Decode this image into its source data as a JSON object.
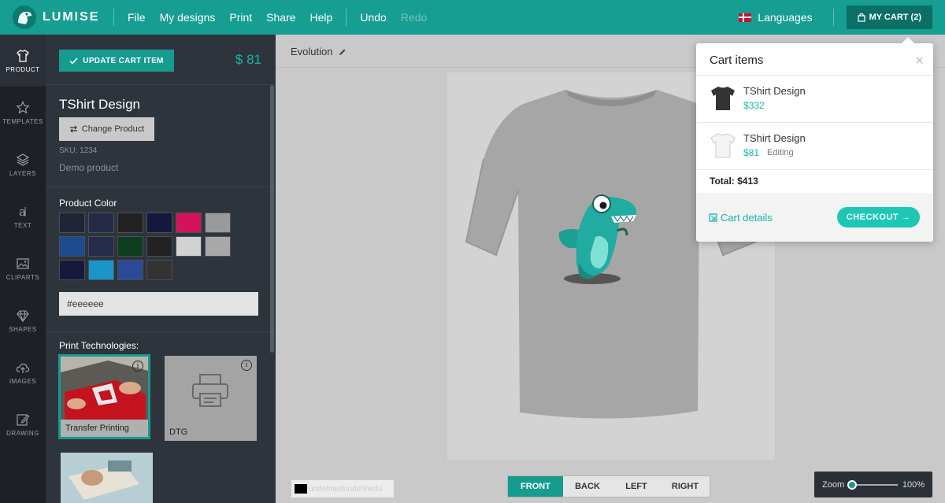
{
  "app": {
    "brand": "LUMISE"
  },
  "menu": {
    "items": [
      "File",
      "My designs",
      "Print",
      "Share",
      "Help"
    ],
    "undo": "Undo",
    "redo": "Redo"
  },
  "top_right": {
    "languages": "Languages",
    "cart_label": "MY CART (2)"
  },
  "rail": [
    {
      "label": "PRODUCT",
      "icon": "tshirt-icon",
      "active": true
    },
    {
      "label": "TEMPLATES",
      "icon": "star-icon"
    },
    {
      "label": "LAYERS",
      "icon": "layers-icon"
    },
    {
      "label": "TEXT",
      "icon": "text-icon"
    },
    {
      "label": "CLIPARTS",
      "icon": "image-icon"
    },
    {
      "label": "SHAPES",
      "icon": "diamond-icon"
    },
    {
      "label": "IMAGES",
      "icon": "cloud-upload-icon"
    },
    {
      "label": "DRAWING",
      "icon": "pencil-icon"
    }
  ],
  "panel": {
    "update_label": "UPDATE CART ITEM",
    "price": "$ 81",
    "product_name": "TShirt Design",
    "change_label": "Change Product",
    "sku": "SKU: 1234",
    "description": "Demo product",
    "color_title": "Product Color",
    "colors": [
      "#1f2436",
      "#262b45",
      "#222222",
      "#15183d",
      "#d4145a",
      "#9a9a9a",
      "#1d4a8e",
      "#262b4c",
      "#0f3d1f",
      "#222222",
      "#d2d2d2",
      "#a8a8a8",
      "#17193a",
      "#1a95c9",
      "#2a4a95",
      "#333333"
    ],
    "color_value": "#eeeeee",
    "print_title": "Print Technologies:",
    "techs": [
      {
        "label": "Transfer Printing",
        "selected": true,
        "info": "i"
      },
      {
        "label": "DTG",
        "selected": false,
        "info": "i"
      }
    ]
  },
  "canvas": {
    "design_name": "Evolution",
    "views": [
      "FRONT",
      "BACK",
      "LEFT",
      "RIGHT"
    ],
    "active_view": "FRONT",
    "layer_text": "undefinedundefinedu",
    "zoom_label": "Zoom",
    "zoom_value": "100%",
    "zoom_level": 0.0
  },
  "cart_popup": {
    "title": "Cart items",
    "close": "×",
    "items": [
      {
        "name": "TShirt Design",
        "price": "$332",
        "status": ""
      },
      {
        "name": "TShirt Design",
        "price": "$81",
        "status": "Editing"
      }
    ],
    "total": "Total: $413",
    "details_label": "Cart details",
    "checkout_label": "CHECKOUT →"
  }
}
